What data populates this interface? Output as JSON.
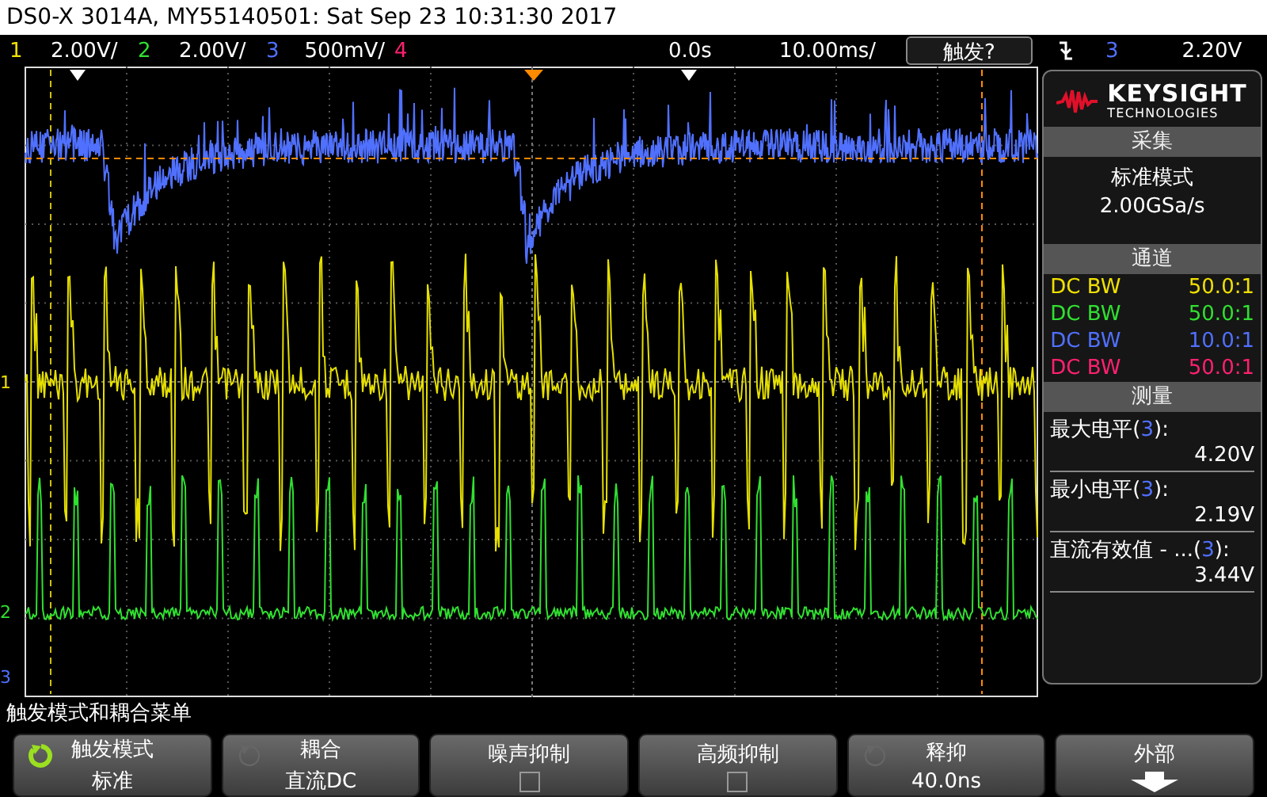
{
  "title_bar": {
    "text": "DS0-X 3014A, MY55140501: Sat Sep 23 10:31:30 2017"
  },
  "channels_bar": [
    {
      "number": "1",
      "scale": "2.00V/",
      "color": "#f0e000"
    },
    {
      "number": "2",
      "scale": "2.00V/",
      "color": "#30e030"
    },
    {
      "number": "3",
      "scale": "500mV/",
      "color": "#5070ff"
    },
    {
      "number": "4",
      "color": "#ff2070"
    }
  ],
  "timebase": {
    "delay": "0.0s",
    "scale": "10.00ms/"
  },
  "trigger": {
    "status": "触发?",
    "source": "3",
    "color": "#5070ff",
    "level": "2.20V"
  },
  "markers": [
    {
      "label": "1",
      "color": "#f0e000"
    },
    {
      "label": "2",
      "color": "#30e030"
    },
    {
      "label": "3",
      "color": "#5070ff"
    }
  ],
  "panel": {
    "logo_name": "KEYSIGHT",
    "logo_sub": "TECHNOLOGIES",
    "acquisition": {
      "header": "采集",
      "mode": "标准模式",
      "rate": "2.00GSa/s"
    },
    "channels": {
      "header": "通道",
      "items": [
        {
          "coupling": "DC BW",
          "probe": "50.0:1",
          "color": "#f0e000"
        },
        {
          "coupling": "DC BW",
          "probe": "50.0:1",
          "color": "#30e030"
        },
        {
          "coupling": "DC BW",
          "probe": "10.0:1",
          "color": "#5070ff"
        },
        {
          "coupling": "DC BW",
          "probe": "50.0:1",
          "color": "#ff2070"
        }
      ]
    },
    "measurements": {
      "header": "测量",
      "items": [
        {
          "prefix": "最大电平(",
          "source": "3",
          "suffix": "):",
          "value": "4.20V",
          "color": "#5070ff"
        },
        {
          "prefix": "最小电平(",
          "source": "3",
          "suffix": "):",
          "value": "2.19V",
          "color": "#5070ff"
        },
        {
          "prefix": "直流有效值 - ...(",
          "source": "3",
          "suffix": "):",
          "value": "3.44V",
          "color": "#5070ff"
        }
      ]
    }
  },
  "menu_title": "触发模式和耦合菜单",
  "softkeys": [
    {
      "kind": "rotary",
      "label": "触发模式",
      "value": "标准",
      "active": true
    },
    {
      "kind": "rotary",
      "label": "耦合",
      "value": "直流DC",
      "active": false
    },
    {
      "kind": "checkbox",
      "label": "噪声抑制",
      "checked": false
    },
    {
      "kind": "checkbox",
      "label": "高频抑制",
      "checked": false
    },
    {
      "kind": "rotary",
      "label": "释抑",
      "value": "40.0ns",
      "active": false
    },
    {
      "kind": "arrow",
      "label": "外部"
    }
  ]
}
